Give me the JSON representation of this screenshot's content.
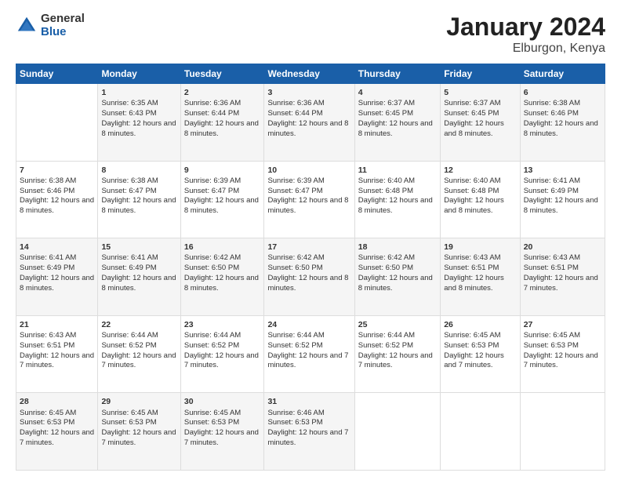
{
  "logo": {
    "general": "General",
    "blue": "Blue"
  },
  "title": "January 2024",
  "subtitle": "Elburgon, Kenya",
  "days_header": [
    "Sunday",
    "Monday",
    "Tuesday",
    "Wednesday",
    "Thursday",
    "Friday",
    "Saturday"
  ],
  "weeks": [
    [
      {
        "day": "",
        "sunrise": "",
        "sunset": "",
        "daylight": ""
      },
      {
        "day": "1",
        "sunrise": "Sunrise: 6:35 AM",
        "sunset": "Sunset: 6:43 PM",
        "daylight": "Daylight: 12 hours and 8 minutes."
      },
      {
        "day": "2",
        "sunrise": "Sunrise: 6:36 AM",
        "sunset": "Sunset: 6:44 PM",
        "daylight": "Daylight: 12 hours and 8 minutes."
      },
      {
        "day": "3",
        "sunrise": "Sunrise: 6:36 AM",
        "sunset": "Sunset: 6:44 PM",
        "daylight": "Daylight: 12 hours and 8 minutes."
      },
      {
        "day": "4",
        "sunrise": "Sunrise: 6:37 AM",
        "sunset": "Sunset: 6:45 PM",
        "daylight": "Daylight: 12 hours and 8 minutes."
      },
      {
        "day": "5",
        "sunrise": "Sunrise: 6:37 AM",
        "sunset": "Sunset: 6:45 PM",
        "daylight": "Daylight: 12 hours and 8 minutes."
      },
      {
        "day": "6",
        "sunrise": "Sunrise: 6:38 AM",
        "sunset": "Sunset: 6:46 PM",
        "daylight": "Daylight: 12 hours and 8 minutes."
      }
    ],
    [
      {
        "day": "7",
        "sunrise": "Sunrise: 6:38 AM",
        "sunset": "Sunset: 6:46 PM",
        "daylight": "Daylight: 12 hours and 8 minutes."
      },
      {
        "day": "8",
        "sunrise": "Sunrise: 6:38 AM",
        "sunset": "Sunset: 6:47 PM",
        "daylight": "Daylight: 12 hours and 8 minutes."
      },
      {
        "day": "9",
        "sunrise": "Sunrise: 6:39 AM",
        "sunset": "Sunset: 6:47 PM",
        "daylight": "Daylight: 12 hours and 8 minutes."
      },
      {
        "day": "10",
        "sunrise": "Sunrise: 6:39 AM",
        "sunset": "Sunset: 6:47 PM",
        "daylight": "Daylight: 12 hours and 8 minutes."
      },
      {
        "day": "11",
        "sunrise": "Sunrise: 6:40 AM",
        "sunset": "Sunset: 6:48 PM",
        "daylight": "Daylight: 12 hours and 8 minutes."
      },
      {
        "day": "12",
        "sunrise": "Sunrise: 6:40 AM",
        "sunset": "Sunset: 6:48 PM",
        "daylight": "Daylight: 12 hours and 8 minutes."
      },
      {
        "day": "13",
        "sunrise": "Sunrise: 6:41 AM",
        "sunset": "Sunset: 6:49 PM",
        "daylight": "Daylight: 12 hours and 8 minutes."
      }
    ],
    [
      {
        "day": "14",
        "sunrise": "Sunrise: 6:41 AM",
        "sunset": "Sunset: 6:49 PM",
        "daylight": "Daylight: 12 hours and 8 minutes."
      },
      {
        "day": "15",
        "sunrise": "Sunrise: 6:41 AM",
        "sunset": "Sunset: 6:49 PM",
        "daylight": "Daylight: 12 hours and 8 minutes."
      },
      {
        "day": "16",
        "sunrise": "Sunrise: 6:42 AM",
        "sunset": "Sunset: 6:50 PM",
        "daylight": "Daylight: 12 hours and 8 minutes."
      },
      {
        "day": "17",
        "sunrise": "Sunrise: 6:42 AM",
        "sunset": "Sunset: 6:50 PM",
        "daylight": "Daylight: 12 hours and 8 minutes."
      },
      {
        "day": "18",
        "sunrise": "Sunrise: 6:42 AM",
        "sunset": "Sunset: 6:50 PM",
        "daylight": "Daylight: 12 hours and 8 minutes."
      },
      {
        "day": "19",
        "sunrise": "Sunrise: 6:43 AM",
        "sunset": "Sunset: 6:51 PM",
        "daylight": "Daylight: 12 hours and 8 minutes."
      },
      {
        "day": "20",
        "sunrise": "Sunrise: 6:43 AM",
        "sunset": "Sunset: 6:51 PM",
        "daylight": "Daylight: 12 hours and 7 minutes."
      }
    ],
    [
      {
        "day": "21",
        "sunrise": "Sunrise: 6:43 AM",
        "sunset": "Sunset: 6:51 PM",
        "daylight": "Daylight: 12 hours and 7 minutes."
      },
      {
        "day": "22",
        "sunrise": "Sunrise: 6:44 AM",
        "sunset": "Sunset: 6:52 PM",
        "daylight": "Daylight: 12 hours and 7 minutes."
      },
      {
        "day": "23",
        "sunrise": "Sunrise: 6:44 AM",
        "sunset": "Sunset: 6:52 PM",
        "daylight": "Daylight: 12 hours and 7 minutes."
      },
      {
        "day": "24",
        "sunrise": "Sunrise: 6:44 AM",
        "sunset": "Sunset: 6:52 PM",
        "daylight": "Daylight: 12 hours and 7 minutes."
      },
      {
        "day": "25",
        "sunrise": "Sunrise: 6:44 AM",
        "sunset": "Sunset: 6:52 PM",
        "daylight": "Daylight: 12 hours and 7 minutes."
      },
      {
        "day": "26",
        "sunrise": "Sunrise: 6:45 AM",
        "sunset": "Sunset: 6:53 PM",
        "daylight": "Daylight: 12 hours and 7 minutes."
      },
      {
        "day": "27",
        "sunrise": "Sunrise: 6:45 AM",
        "sunset": "Sunset: 6:53 PM",
        "daylight": "Daylight: 12 hours and 7 minutes."
      }
    ],
    [
      {
        "day": "28",
        "sunrise": "Sunrise: 6:45 AM",
        "sunset": "Sunset: 6:53 PM",
        "daylight": "Daylight: 12 hours and 7 minutes."
      },
      {
        "day": "29",
        "sunrise": "Sunrise: 6:45 AM",
        "sunset": "Sunset: 6:53 PM",
        "daylight": "Daylight: 12 hours and 7 minutes."
      },
      {
        "day": "30",
        "sunrise": "Sunrise: 6:45 AM",
        "sunset": "Sunset: 6:53 PM",
        "daylight": "Daylight: 12 hours and 7 minutes."
      },
      {
        "day": "31",
        "sunrise": "Sunrise: 6:46 AM",
        "sunset": "Sunset: 6:53 PM",
        "daylight": "Daylight: 12 hours and 7 minutes."
      },
      {
        "day": "",
        "sunrise": "",
        "sunset": "",
        "daylight": ""
      },
      {
        "day": "",
        "sunrise": "",
        "sunset": "",
        "daylight": ""
      },
      {
        "day": "",
        "sunrise": "",
        "sunset": "",
        "daylight": ""
      }
    ]
  ]
}
